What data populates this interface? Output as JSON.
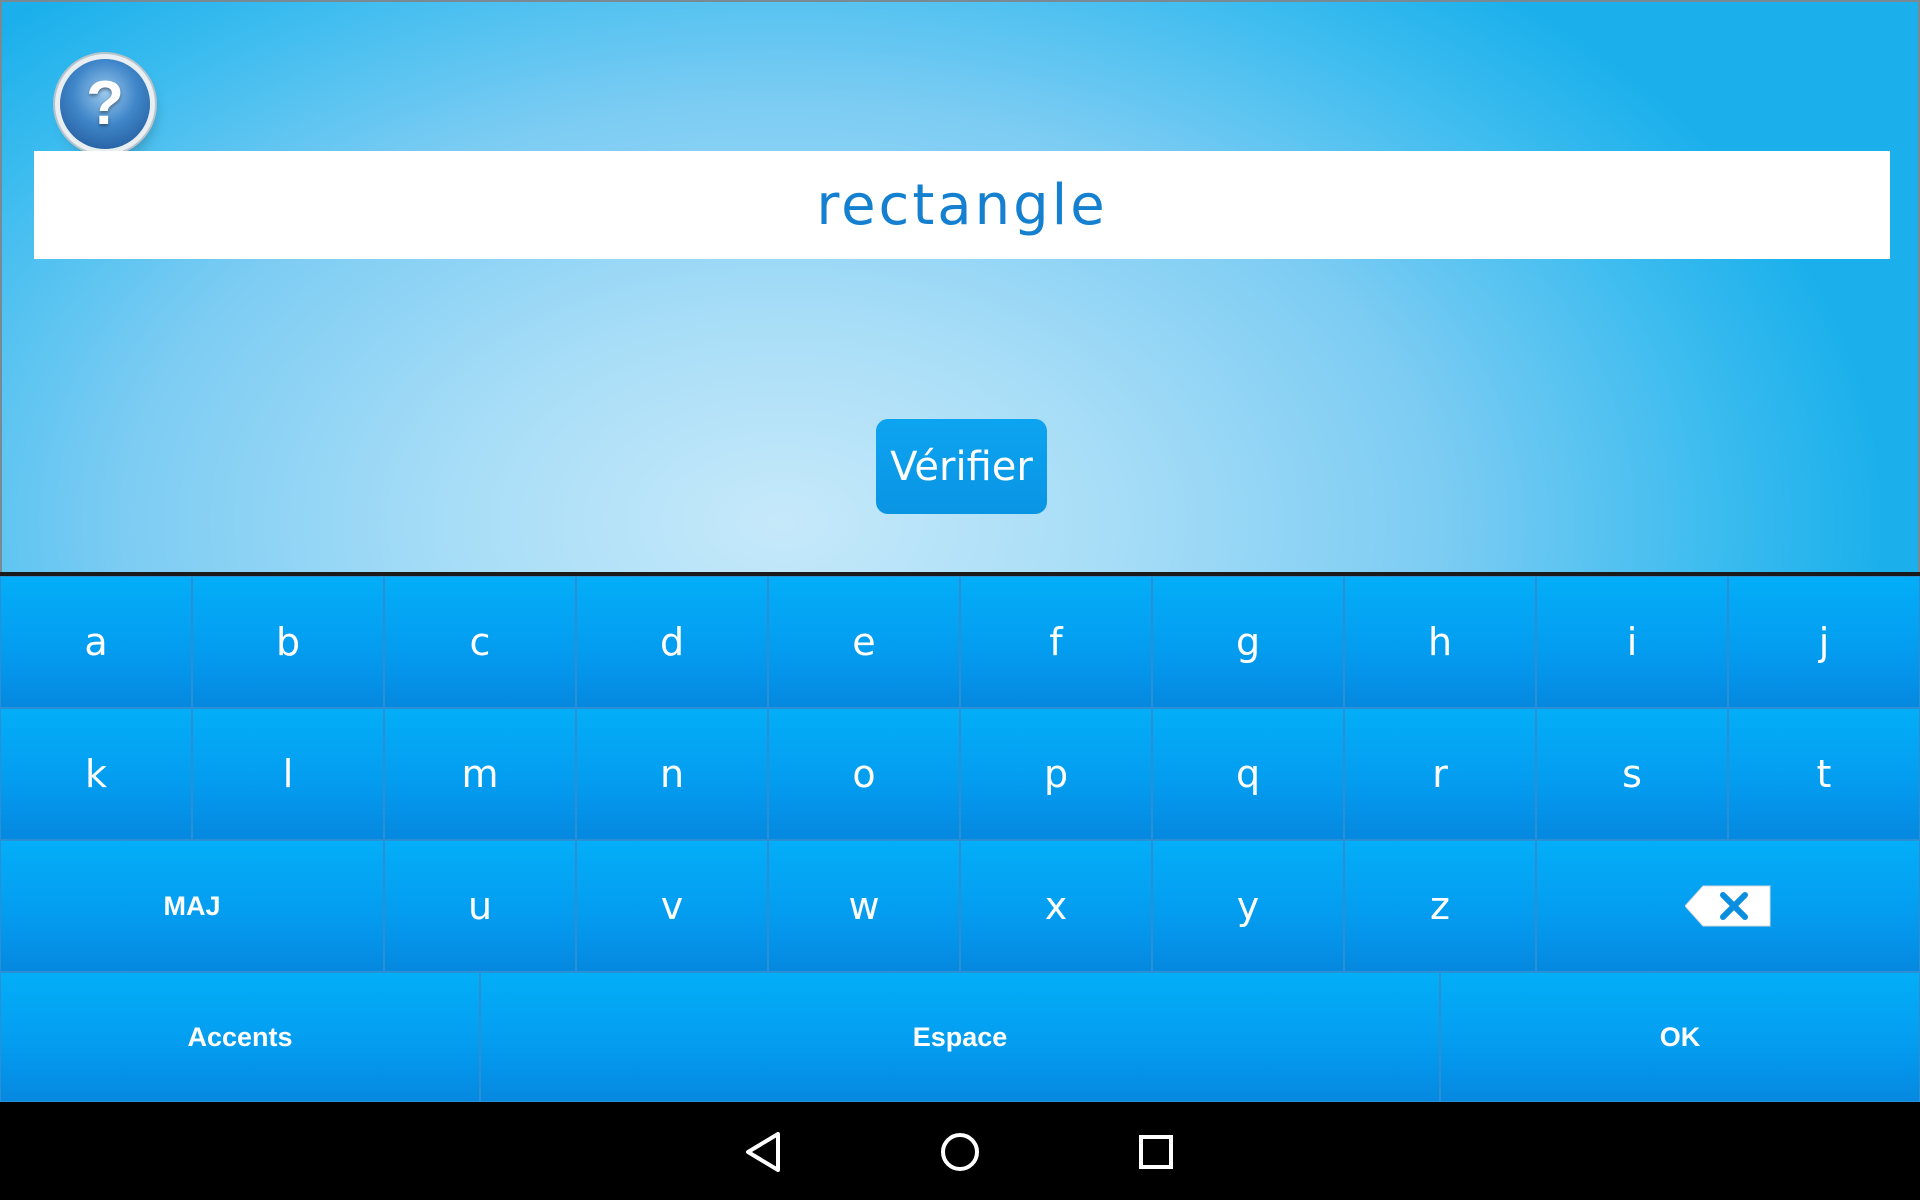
{
  "app": {
    "help_icon": "question-mark-icon",
    "help_symbol": "?",
    "word": "rectangle",
    "verify_label": "Vérifier"
  },
  "keyboard": {
    "row1": [
      "a",
      "b",
      "c",
      "d",
      "e",
      "f",
      "g",
      "h",
      "i",
      "j"
    ],
    "row2": [
      "k",
      "l",
      "m",
      "n",
      "o",
      "p",
      "q",
      "r",
      "s",
      "t"
    ],
    "row3": [
      "u",
      "v",
      "w",
      "x",
      "y",
      "z"
    ],
    "shift_label": "MAJ",
    "backspace_icon": "backspace-icon",
    "accents_label": "Accents",
    "space_label": "Espace",
    "ok_label": "OK"
  },
  "navbar": {
    "back_icon": "back-triangle-icon",
    "home_icon": "home-circle-icon",
    "recents_icon": "recents-square-icon"
  },
  "colors": {
    "key_blue": "#049df0",
    "word_blue": "#1580d0",
    "background_light": "#c6e9fa"
  }
}
